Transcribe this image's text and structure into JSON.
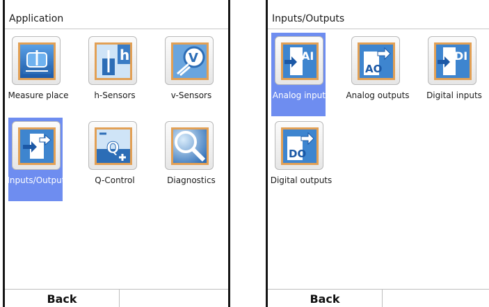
{
  "left_screen": {
    "title": "Application",
    "tiles": [
      {
        "label": "Measure place",
        "icon": "measure-place-icon"
      },
      {
        "label": "h-Sensors",
        "icon": "h-sensors-icon"
      },
      {
        "label": "v-Sensors",
        "icon": "v-sensors-icon"
      },
      {
        "label": "Inputs/Outputs",
        "icon": "inputs-outputs-icon",
        "selected": true
      },
      {
        "label": "Q-Control",
        "icon": "q-control-icon"
      },
      {
        "label": "Diagnostics",
        "icon": "diagnostics-icon"
      }
    ],
    "footer": {
      "back_label": "Back",
      "right_label": ""
    }
  },
  "right_screen": {
    "title": "Inputs/Outputs",
    "tiles": [
      {
        "label": "Analog inputs",
        "icon": "analog-inputs-icon",
        "selected": true
      },
      {
        "label": "Analog outputs",
        "icon": "analog-outputs-icon"
      },
      {
        "label": "Digital inputs",
        "icon": "digital-inputs-icon"
      },
      {
        "label": "Digital outputs",
        "icon": "digital-outputs-icon"
      }
    ],
    "footer": {
      "back_label": "Back",
      "right_label": ""
    }
  },
  "icon_text": {
    "h": "h",
    "v": "V",
    "q": "Q",
    "ai": "AI",
    "ao": "AO",
    "di": "DI",
    "do": "DO"
  },
  "colors": {
    "selection": "#6e8df0",
    "icon_border": "#e2a055",
    "icon_blue": "#2c6db6"
  }
}
